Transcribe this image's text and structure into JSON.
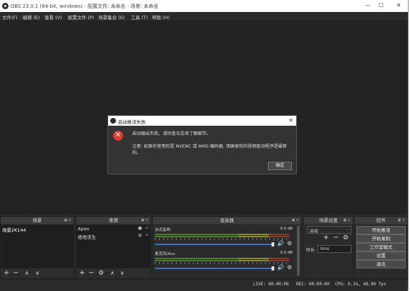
{
  "titlebar": {
    "title": "OBS 23.0.1 (64-bit, windows) - 配置文件: 未命名 - 场景: 未命名",
    "minimize": "—",
    "maximize": "☐",
    "close": "✕"
  },
  "menu": [
    "文件(F)",
    "编辑 (E)",
    "查看 (V)",
    "配置文件 (P)",
    "场景集合 (S)",
    "工具 (T)",
    "帮助 (H)"
  ],
  "dialog": {
    "title": "启动推流失败",
    "line1": "启动输出失败。请检查日志来了解细节。",
    "line2": "注意: 如果你使用的是 NVENC 或 AMD 编码器, 请确保你的视频驱动程序是最新",
    "line3": "的。",
    "ok": "确定"
  },
  "docks": {
    "scenes": {
      "title": "场景",
      "items": [
        "场景2K144"
      ]
    },
    "sources": {
      "title": "来源",
      "items": [
        "Apex",
        "绝地求生"
      ]
    },
    "mixer": {
      "title": "混音器",
      "channels": [
        {
          "name": "台式音响",
          "db": "0.0 dB"
        },
        {
          "name": "麦克风/Aux",
          "db": "0.0 dB"
        }
      ]
    },
    "transitions": {
      "title": "场景过渡",
      "type": "淡出",
      "duration_label": "时长",
      "duration": "0ms"
    },
    "controls": {
      "title": "控件",
      "buttons": [
        "开始推流",
        "开始录制",
        "工作室模式",
        "设置",
        "退出"
      ]
    }
  },
  "status": {
    "live": "LIVE: 00:00:00",
    "rec": "REC: 00:00:00",
    "cpu": "CPU: 0.1%, 48.00 fps"
  },
  "colors": {
    "accent": "#3a6fd0",
    "error": "#e23b2e",
    "background": "#2b2b2b"
  }
}
